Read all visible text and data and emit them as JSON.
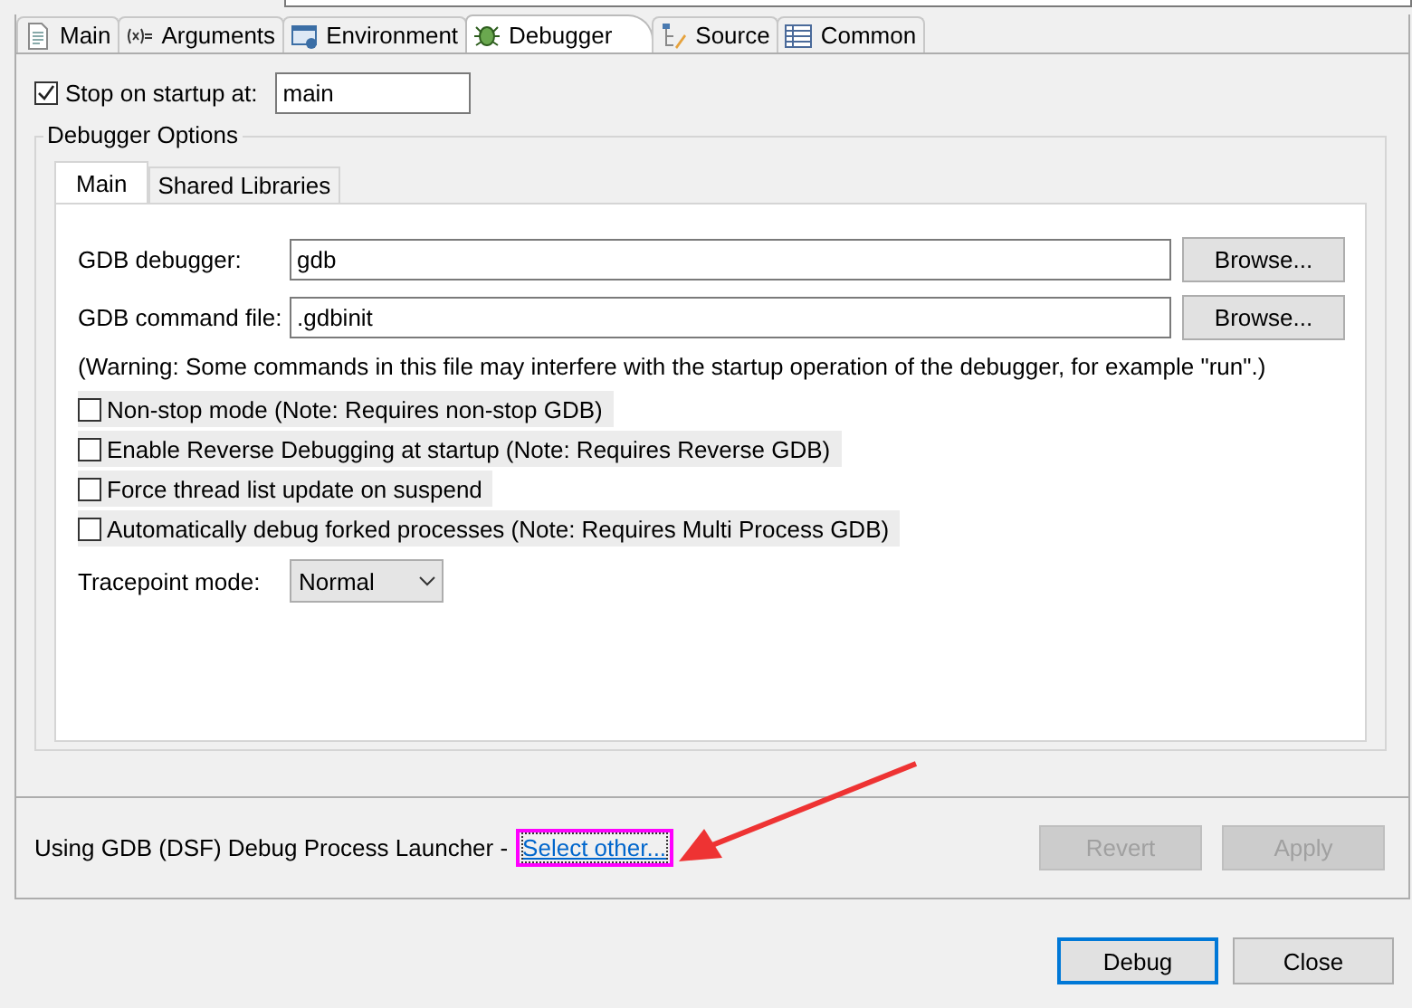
{
  "tabs": [
    {
      "label": "Main",
      "kind": "document",
      "selected": false
    },
    {
      "label": "Arguments",
      "kind": "variables",
      "selected": false
    },
    {
      "label": "Environment",
      "kind": "window",
      "selected": false
    },
    {
      "label": "Debugger",
      "kind": "bug",
      "selected": true
    },
    {
      "label": "Source",
      "kind": "tree",
      "selected": false
    },
    {
      "label": "Common",
      "kind": "table",
      "selected": false
    }
  ],
  "stop_on_startup": {
    "label": "Stop on startup at:",
    "checked": true,
    "value": "main"
  },
  "debugger_options": {
    "title": "Debugger Options",
    "tabs": [
      {
        "label": "Main",
        "selected": true
      },
      {
        "label": "Shared Libraries",
        "selected": false
      }
    ],
    "fields": [
      {
        "label": "GDB debugger:",
        "value": "gdb",
        "button": "Browse..."
      },
      {
        "label": "GDB command file:",
        "value": ".gdbinit",
        "button": "Browse..."
      }
    ],
    "warning": "(Warning: Some commands in this file may interfere with the startup operation of the debugger, for example \"run\".)",
    "options": [
      {
        "label": "Non-stop mode (Note: Requires non-stop GDB)",
        "checked": false
      },
      {
        "label": "Enable Reverse Debugging at startup (Note: Requires Reverse GDB)",
        "checked": false
      },
      {
        "label": "Force thread list update on suspend",
        "checked": false
      },
      {
        "label": "Automatically debug forked processes (Note: Requires Multi Process GDB)",
        "checked": false
      }
    ],
    "tracepoint_mode": {
      "label": "Tracepoint mode:",
      "value": "Normal"
    }
  },
  "launcher": {
    "text": "Using GDB (DSF) Debug Process Launcher -",
    "link": "Select other...",
    "highlighted": true
  },
  "panel_buttons": [
    {
      "label": "Revert",
      "disabled": true
    },
    {
      "label": "Apply",
      "disabled": true
    }
  ],
  "dialog_buttons": [
    {
      "label": "Debug",
      "default": true
    },
    {
      "label": "Close",
      "default": false
    }
  ]
}
